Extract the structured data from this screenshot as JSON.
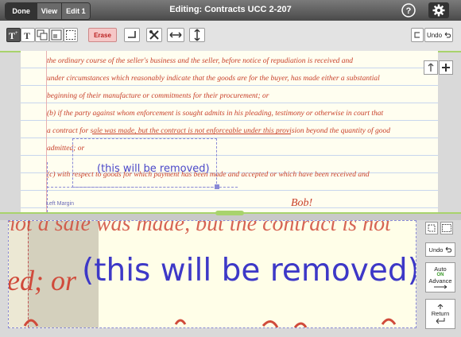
{
  "topbar": {
    "tabs": [
      {
        "label": "Done"
      },
      {
        "label": "View"
      },
      {
        "label": "Edit 1"
      }
    ],
    "title": "Editing: Contracts UCC 2-207",
    "icons": [
      "help-icon",
      "gear-icon"
    ]
  },
  "toolbar": {
    "erase_label": "Erase",
    "undo_label": "Undo"
  },
  "page": {
    "lines": [
      "the ordinary course of the seller's business and the seller, before notice of repudiation is received and",
      "under circumstances which reasonably indicate that the goods are for the buyer, has made either a substantial",
      "beginning of their manufacture or commitments for their procurement; or",
      "(b) if the party against whom enforcement is sought admits in his pleading, testimony or otherwise in court that",
      "a contract for sale was made, but the contract is not enforceable under this provision beyond the quantity of good",
      "admitted; or",
      "(c) with respect to goods for which payment has been made and accepted or which have been received and"
    ],
    "selected_text": "(this will be removed)",
    "margin_label": "Left Margin",
    "fragment": "Bob!"
  },
  "zoom": {
    "big_text": "(this will be removed)",
    "red_prefix": "ed; or",
    "top_red": "not a sale was made, but the contract is not"
  },
  "rightpanel": {
    "undo_label": "Undo",
    "auto_label": "Auto",
    "auto_state": "ON",
    "advance_label": "Advance",
    "return_label": "Return"
  }
}
